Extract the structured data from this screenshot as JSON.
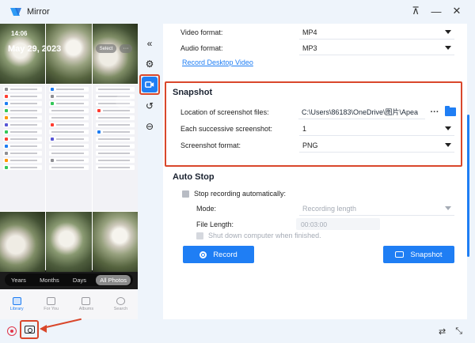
{
  "window": {
    "title": "Mirror",
    "controls": [
      "pin-icon",
      "minimize-icon",
      "close-icon"
    ]
  },
  "phone": {
    "time": "14:06",
    "date": "May 29, 2023",
    "select_label": "Select",
    "more_label": "···",
    "segments": [
      "Years",
      "Months",
      "Days",
      "All Photos"
    ],
    "active_segment": "All Photos",
    "tabs": [
      "Library",
      "For You",
      "Albums",
      "Search"
    ],
    "active_tab": "Library"
  },
  "sidebar": {
    "items": [
      "collapse-icon",
      "settings-icon",
      "video-icon",
      "history-icon",
      "more-icon"
    ],
    "active": "video-icon"
  },
  "settings": {
    "video_format_label": "Video format:",
    "video_format_value": "MP4",
    "audio_format_label": "Audio format:",
    "audio_format_value": "MP3",
    "record_desktop_link": "Record Desktop Video",
    "snapshot": {
      "title": "Snapshot",
      "location_label": "Location of screenshot files:",
      "location_value": "C:\\Users\\86183\\OneDrive\\图片\\Apea",
      "more_label": "···",
      "successive_label": "Each successive screenshot:",
      "successive_value": "1",
      "format_label": "Screenshot format:",
      "format_value": "PNG"
    },
    "auto_stop": {
      "title": "Auto Stop",
      "stop_label": "Stop recording automatically:",
      "mode_label": "Mode:",
      "mode_value": "Recording length",
      "file_length_label": "File Length:",
      "file_length_value": "00:03:00",
      "shutdown_label": "Shut down computer when finished."
    },
    "record_button": "Record",
    "snapshot_button": "Snapshot"
  },
  "bottom": {
    "right_icons": [
      "hide-icon",
      "scale-icon"
    ]
  },
  "colors": {
    "accent": "#1f7ef4",
    "annotation": "#d9472b",
    "record": "#e0364a"
  }
}
